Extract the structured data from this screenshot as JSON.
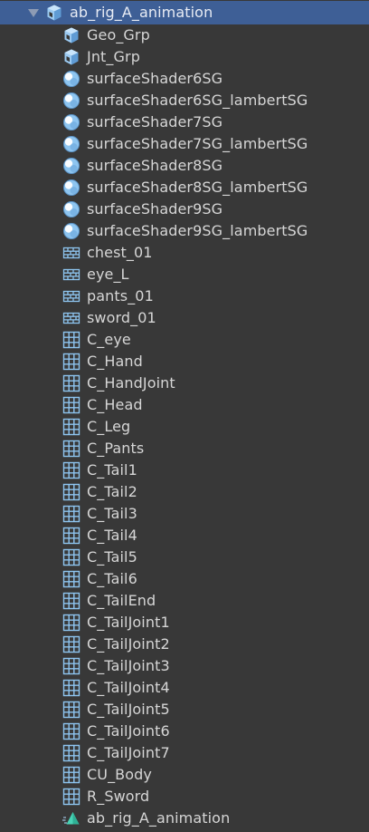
{
  "root": {
    "label": "ab_rig_A_animation",
    "icon": "prefab-cube-icon"
  },
  "items": [
    {
      "label": "Geo_Grp",
      "icon": "prefab-cube-icon"
    },
    {
      "label": "Jnt_Grp",
      "icon": "prefab-cube-icon"
    },
    {
      "label": "surfaceShader6SG",
      "icon": "material-sphere-icon"
    },
    {
      "label": "surfaceShader6SG_lambertSG",
      "icon": "material-sphere-icon"
    },
    {
      "label": "surfaceShader7SG",
      "icon": "material-sphere-icon"
    },
    {
      "label": "surfaceShader7SG_lambertSG",
      "icon": "material-sphere-icon"
    },
    {
      "label": "surfaceShader8SG",
      "icon": "material-sphere-icon"
    },
    {
      "label": "surfaceShader8SG_lambertSG",
      "icon": "material-sphere-icon"
    },
    {
      "label": "surfaceShader9SG",
      "icon": "material-sphere-icon"
    },
    {
      "label": "surfaceShader9SG_lambertSG",
      "icon": "material-sphere-icon"
    },
    {
      "label": "chest_01",
      "icon": "mesh-brick-icon"
    },
    {
      "label": "eye_L",
      "icon": "mesh-brick-icon"
    },
    {
      "label": "pants_01",
      "icon": "mesh-brick-icon"
    },
    {
      "label": "sword_01",
      "icon": "mesh-brick-icon"
    },
    {
      "label": "C_eye",
      "icon": "grid-mesh-icon"
    },
    {
      "label": "C_Hand",
      "icon": "grid-mesh-icon"
    },
    {
      "label": "C_HandJoint",
      "icon": "grid-mesh-icon"
    },
    {
      "label": "C_Head",
      "icon": "grid-mesh-icon"
    },
    {
      "label": "C_Leg",
      "icon": "grid-mesh-icon"
    },
    {
      "label": "C_Pants",
      "icon": "grid-mesh-icon"
    },
    {
      "label": "C_Tail1",
      "icon": "grid-mesh-icon"
    },
    {
      "label": "C_Tail2",
      "icon": "grid-mesh-icon"
    },
    {
      "label": "C_Tail3",
      "icon": "grid-mesh-icon"
    },
    {
      "label": "C_Tail4",
      "icon": "grid-mesh-icon"
    },
    {
      "label": "C_Tail5",
      "icon": "grid-mesh-icon"
    },
    {
      "label": "C_Tail6",
      "icon": "grid-mesh-icon"
    },
    {
      "label": "C_TailEnd",
      "icon": "grid-mesh-icon"
    },
    {
      "label": "C_TailJoint1",
      "icon": "grid-mesh-icon"
    },
    {
      "label": "C_TailJoint2",
      "icon": "grid-mesh-icon"
    },
    {
      "label": "C_TailJoint3",
      "icon": "grid-mesh-icon"
    },
    {
      "label": "C_TailJoint4",
      "icon": "grid-mesh-icon"
    },
    {
      "label": "C_TailJoint5",
      "icon": "grid-mesh-icon"
    },
    {
      "label": "C_TailJoint6",
      "icon": "grid-mesh-icon"
    },
    {
      "label": "C_TailJoint7",
      "icon": "grid-mesh-icon"
    },
    {
      "label": "CU_Body",
      "icon": "grid-mesh-icon"
    },
    {
      "label": "R_Sword",
      "icon": "grid-mesh-icon"
    },
    {
      "label": "ab_rig_A_animation",
      "icon": "animation-clip-icon"
    }
  ],
  "colors": {
    "background": "#383838",
    "selection": "#3e5f96",
    "icon_blue": "#8ec5f0",
    "text": "#d6d6d6"
  }
}
